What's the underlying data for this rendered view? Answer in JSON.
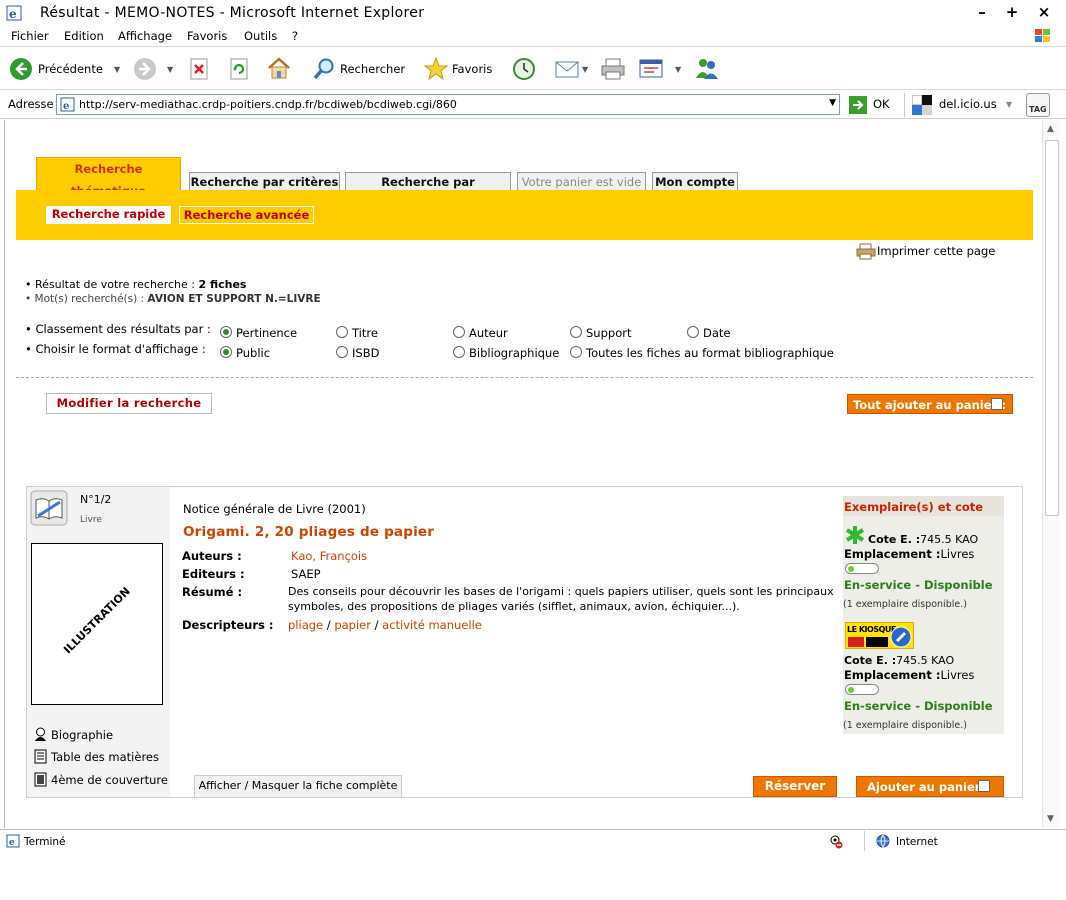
{
  "window": {
    "title": "Résultat - MEMO-NOTES - Microsoft Internet Explorer"
  },
  "menubar": [
    "Fichier",
    "Edition",
    "Affichage",
    "Favoris",
    "Outils",
    "?"
  ],
  "toolbar": {
    "back_label": "Précédente",
    "search_label": "Rechercher",
    "favorites_label": "Favoris"
  },
  "addressbar": {
    "label": "Adresse",
    "url": "http://serv-mediathac.crdp-poitiers.cndp.fr/bcdiweb/bcdiweb.cgi/860",
    "go_label": "OK",
    "delicious_label": "del.icio.us",
    "tag_label": "TAG"
  },
  "tabs": [
    {
      "label": "Recherche thématique",
      "state": "active"
    },
    {
      "label": "Recherche par critères",
      "state": "normal"
    },
    {
      "label": "Recherche par Thésaurus",
      "state": "normal"
    },
    {
      "label": "Votre panier est vide",
      "state": "disabled"
    },
    {
      "label": "Mon compte",
      "state": "normal"
    }
  ],
  "subtabs": {
    "quick": "Recherche rapide",
    "advanced": "Recherche avancée"
  },
  "print_label": "Imprimer cette page",
  "result": {
    "prefix": "• Résultat de votre recherche : ",
    "count": "2 fiches",
    "words_prefix": "• Mot(s) recherché(s) : ",
    "words": "AVION ET SUPPORT N.=LIVRE"
  },
  "sort": {
    "label": "• Classement des résultats par :",
    "options": [
      "Pertinence",
      "Titre",
      "Auteur",
      "Support",
      "Date"
    ],
    "selected": "Pertinence"
  },
  "format": {
    "label": "• Choisir le format d'affichage :",
    "options": [
      "Public",
      "ISBD",
      "Bibliographique",
      "Toutes les fiches au format bibliographique"
    ],
    "selected": "Public"
  },
  "modify_label": "Modifier la recherche",
  "add_all_label": "Tout ajouter au panier :",
  "record": {
    "number": "N°1/2",
    "type": "Livre",
    "illustration": "ILLUSTRATION",
    "notice": "Notice générale de Livre  (2001)",
    "title": "Origami. 2, 20 pliages de papier",
    "authors_label": "Auteurs :",
    "authors": "Kao, François",
    "editors_label": "Editeurs :",
    "editors": "SAEP",
    "summary_label": "Résumé :",
    "summary_line1": "Des conseils pour découvrir les bases de l'origami : quels papiers utiliser, quels sont les principaux",
    "summary_line2": "symboles, des propositions de pliages variés (sifflet, animaux, avion, échiquier...).",
    "descriptors_label": "Descripteurs :",
    "descriptors": [
      "pliage",
      "papier",
      "activité manuelle"
    ],
    "left_links": [
      "Biographie",
      "Table des matières",
      "4ème de couverture"
    ],
    "toggle_label": "Afficher / Masquer la fiche complète",
    "reserve_label": "Réserver",
    "add_label": "Ajouter au panier :"
  },
  "copies": {
    "header": "Exemplaire(s) et cote",
    "cote_label": "Cote E. :",
    "cote": "745.5 KAO",
    "location_label": "Emplacement :",
    "location": "Livres",
    "status": "En-service - Disponible",
    "available": "(1 exemplaire disponible.)",
    "kiosque_logo": "LE KIOSQUE"
  },
  "status": {
    "text": "Terminé",
    "zone": "Internet"
  }
}
